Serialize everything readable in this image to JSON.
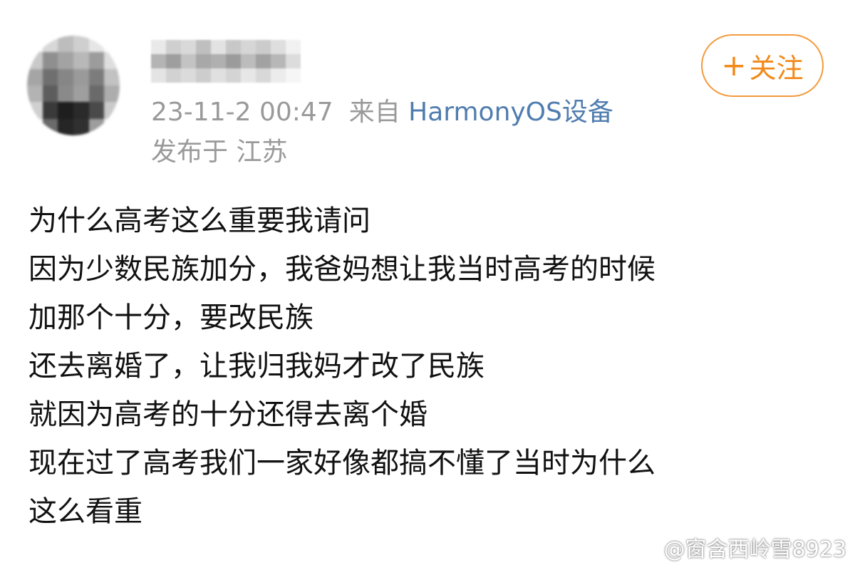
{
  "post": {
    "avatar_icon": "avatar-pixelated",
    "username_icon": "username-pixelated",
    "timestamp": "23-11-2 00:47",
    "source_prefix": "来自",
    "source_device": "HarmonyOS设备",
    "location": "发布于 江苏",
    "follow_button": {
      "icon": "plus-icon",
      "plus": "+",
      "label": "关注",
      "color": "#f28a1a"
    },
    "lines": [
      "为什么高考这么重要我请问",
      "因为少数民族加分，我爸妈想让我当时高考的时候",
      "加那个十分，要改民族",
      "还去离婚了，让我归我妈才改了民族",
      "就因为高考的十分还得去离个婚",
      "现在过了高考我们一家好像都搞不懂了当时为什么",
      "这么看重"
    ]
  },
  "watermark": {
    "icon": "weibo-icon",
    "text": "@窗含西岭雪8923"
  },
  "colors": {
    "meta_gray": "#9a9a9a",
    "link_blue": "#507daf",
    "accent_orange": "#f28a1a"
  }
}
